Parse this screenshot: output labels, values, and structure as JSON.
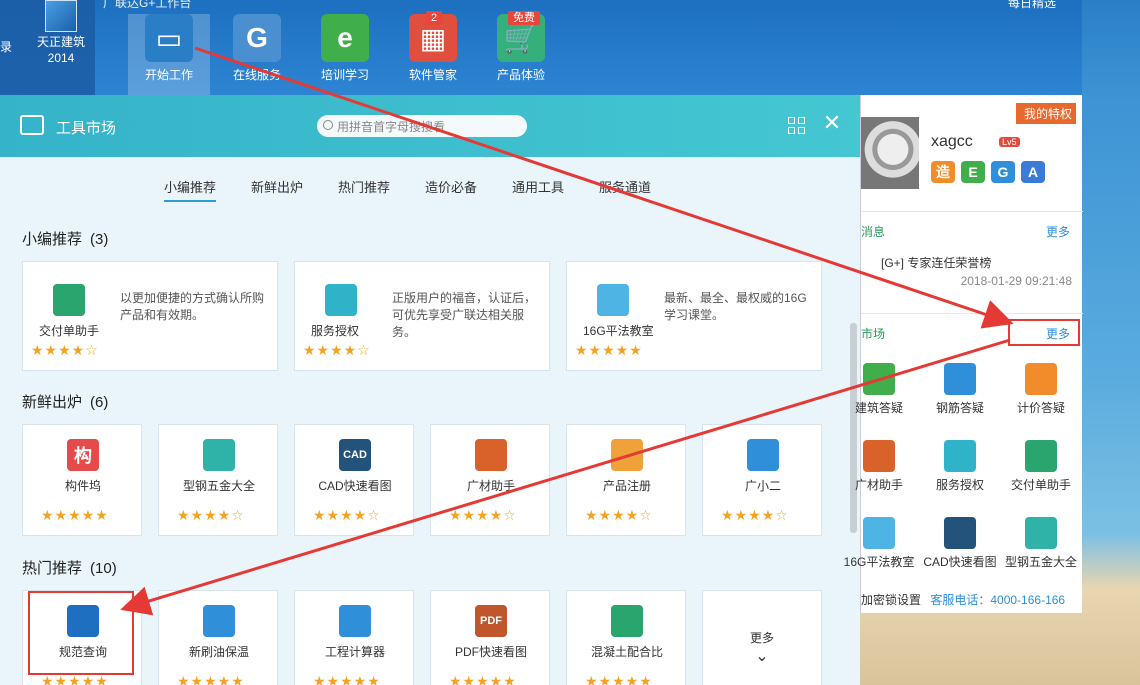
{
  "desktop": {
    "icon_label": "天正建筑\n2014",
    "edge_text": "录"
  },
  "topbar": {
    "title": "广联达G+工作台",
    "right_text": "每日精选"
  },
  "nav": [
    {
      "label": "开始工作",
      "icon": "monitor-icon",
      "active": true
    },
    {
      "label": "在线服务",
      "icon": "globe-g-icon"
    },
    {
      "label": "培训学习",
      "icon": "ie-icon"
    },
    {
      "label": "软件管家",
      "icon": "apps-icon",
      "badge": "2"
    },
    {
      "label": "产品体验",
      "icon": "basket-icon",
      "badge": "免费"
    }
  ],
  "market": {
    "title": "工具市场",
    "search_placeholder": "用拼音首字母搜搜看",
    "tabs": [
      "小编推荐",
      "新鲜出炉",
      "热门推荐",
      "造价必备",
      "通用工具",
      "服务通道"
    ],
    "sections": [
      {
        "title": "小编推荐",
        "count": "(3)",
        "cards": [
          {
            "name": "交付单助手",
            "desc": "以更加便捷的方式确认所购产品和有效期。",
            "stars": "★★★★☆",
            "color": "#2aa56d",
            "icon": "document-check-icon"
          },
          {
            "name": "服务授权",
            "desc": "正版用户的福音，认证后，可优先享受广联达相关服务。",
            "stars": "★★★★☆",
            "color": "#2fb3c8",
            "icon": "lock-person-icon"
          },
          {
            "name": "16G平法教室",
            "desc": "最新、最全、最权威的16G学习课堂。",
            "stars": "★★★★★",
            "color": "#4db4e3",
            "icon": "book-icon"
          }
        ]
      },
      {
        "title": "新鲜出炉",
        "count": "(6)",
        "cards": [
          {
            "name": "构件坞",
            "stars": "★★★★★",
            "color": "#e54b4b",
            "icon": "gou-icon",
            "glyph": "构"
          },
          {
            "name": "型钢五金大全",
            "stars": "★★★★☆",
            "color": "#2fb3a8",
            "icon": "steel-book-icon"
          },
          {
            "name": "CAD快速看图",
            "stars": "★★★★☆",
            "color": "#23527a",
            "icon": "cad-icon",
            "glyph": "CAD"
          },
          {
            "name": "广材助手",
            "stars": "★★★★☆",
            "color": "#d9622b",
            "icon": "brick-search-icon"
          },
          {
            "name": "产品注册",
            "stars": "★★★★☆",
            "color": "#f0a23a",
            "icon": "register-pen-icon"
          },
          {
            "name": "广小二",
            "stars": "★★★★☆",
            "color": "#2f8fd8",
            "icon": "mascot-icon"
          }
        ]
      },
      {
        "title": "热门推荐",
        "count": "(10)",
        "cards": [
          {
            "name": "规范查询",
            "stars": "★★★★★",
            "color": "#1e6fc0",
            "icon": "book-search-icon"
          },
          {
            "name": "新刷油保温",
            "stars": "★★★★★",
            "color": "#2f8fd8",
            "icon": "building-icon"
          },
          {
            "name": "工程计算器",
            "stars": "★★★★★",
            "color": "#2f8fd8",
            "icon": "calculator-icon"
          },
          {
            "name": "PDF快速看图",
            "stars": "★★★★★",
            "color": "#c0562b",
            "icon": "pdf-icon",
            "glyph": "PDF"
          },
          {
            "name": "混凝土配合比",
            "stars": "★★★★★",
            "color": "#2aa56d",
            "icon": "truck-icon"
          }
        ],
        "more": "更多"
      }
    ]
  },
  "side": {
    "vip": "我的特权",
    "username": "xagcc",
    "level": "Lv5",
    "skills": [
      {
        "t": "造",
        "c": "#f08c2a"
      },
      {
        "t": "E",
        "c": "#3fae4b"
      },
      {
        "t": "G",
        "c": "#2f8fd8"
      },
      {
        "t": "A",
        "c": "#3a7ad8"
      }
    ],
    "msg_title": "消息",
    "more": "更多",
    "msg_text": "[G+] 专家连任荣誉榜",
    "msg_time": "2018-01-29 09:21:48",
    "market_title": "市场",
    "tools": [
      {
        "n": "建筑答疑",
        "c": "#3fae4b",
        "icon": "ruler-icon"
      },
      {
        "n": "钢筋答疑",
        "c": "#2f8fd8",
        "icon": "chat-bubble-icon"
      },
      {
        "n": "计价答疑",
        "c": "#f08c2a",
        "icon": "price-tag-icon"
      },
      {
        "n": "广材助手",
        "c": "#d9622b",
        "icon": "brick-search-icon"
      },
      {
        "n": "服务授权",
        "c": "#2fb3c8",
        "icon": "lock-person-icon"
      },
      {
        "n": "交付单助手",
        "c": "#2aa56d",
        "icon": "document-check-icon"
      },
      {
        "n": "16G平法教室",
        "c": "#4db4e3",
        "icon": "book-icon"
      },
      {
        "n": "CAD快速看图",
        "c": "#23527a",
        "icon": "cad-icon"
      },
      {
        "n": "型钢五金大全",
        "c": "#2fb3a8",
        "icon": "steel-book-icon"
      }
    ],
    "footer_left": "加密锁设置",
    "footer_tel": "客服电话：4000-166-166"
  }
}
